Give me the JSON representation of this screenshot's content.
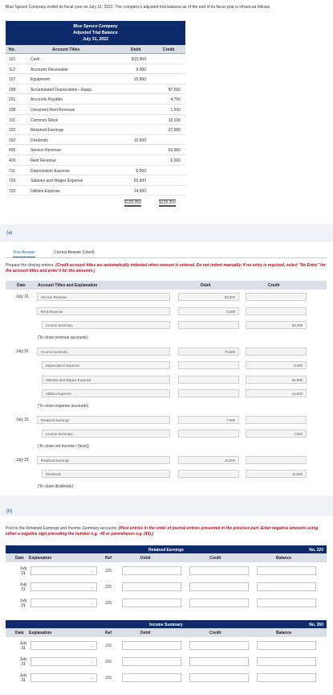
{
  "intro": "Blue Spruce Company ended its fiscal year on July 31, 2022. The company's adjusted trial balance as of the end of its fiscal year is shown as follows.",
  "trial_balance": {
    "title_lines": [
      "Blue Spruce Company",
      "Adjusted Trial Balance",
      "July 31, 2022"
    ],
    "headers": {
      "no": "No.",
      "account": "Account Titles",
      "debit": "Debit",
      "credit": "Credit"
    },
    "rows": [
      {
        "no": "101",
        "account": "Cash",
        "debit": "$10,450",
        "credit": ""
      },
      {
        "no": "112",
        "account": "Accounts Receivable",
        "debit": "9,000",
        "credit": ""
      },
      {
        "no": "157",
        "account": "Equipment",
        "debit": "15,500",
        "credit": ""
      },
      {
        "no": "158",
        "account": "Accumulated Depreciation—Equip.",
        "debit": "",
        "credit": "$7,000"
      },
      {
        "no": "201",
        "account": "Accounts Payable",
        "debit": "",
        "credit": "4,750"
      },
      {
        "no": "208",
        "account": "Unearned Rent Revenue",
        "debit": "",
        "credit": "1,500"
      },
      {
        "no": "311",
        "account": "Common Stock",
        "debit": "",
        "credit": "19,100"
      },
      {
        "no": "320",
        "account": "Retained Earnings",
        "debit": "",
        "credit": "27,000"
      },
      {
        "no": "332",
        "account": "Dividends",
        "debit": "16,500",
        "credit": ""
      },
      {
        "no": "400",
        "account": "Service Revenue",
        "debit": "",
        "credit": "63,000"
      },
      {
        "no": "429",
        "account": "Rent Revenue",
        "debit": "",
        "credit": "6,000"
      },
      {
        "no": "711",
        "account": "Depreciation Expense",
        "debit": "6,500",
        "credit": ""
      },
      {
        "no": "726",
        "account": "Salaries and Wages Expense",
        "debit": "55,900",
        "credit": ""
      },
      {
        "no": "732",
        "account": "Utilities Expense",
        "debit": "14,500",
        "credit": ""
      }
    ],
    "totals": {
      "debit": "$128,350",
      "credit": "$128,350"
    }
  },
  "part_a": {
    "label": "(a)",
    "tabs": [
      "Your Answer",
      "Correct Answer (Used)"
    ],
    "instruction": "Prepare the closing entries.",
    "instruction_red": "(Credit account titles are automatically indented when amount is entered. Do not indent manually. If no entry is required, select \"No Entry\" for the account titles and enter 0 for the amounts.)",
    "headers": {
      "date": "Date",
      "account": "Account Titles and Explanation",
      "debit": "Debit",
      "credit": "Credit"
    },
    "entries": [
      {
        "date": "July 31",
        "lines": [
          {
            "account": "Service Revenue",
            "debit": "63,000",
            "credit": ""
          },
          {
            "account": "Rent Revenue",
            "debit": "6,000",
            "credit": ""
          },
          {
            "account": "Income Summary",
            "debit": "",
            "credit": "69,000"
          }
        ],
        "note": "(To close revenue accounts)"
      },
      {
        "date": "July 31",
        "lines": [
          {
            "account": "Income Summary",
            "debit": "76,900",
            "credit": ""
          },
          {
            "account": "Depreciation Expense",
            "debit": "",
            "credit": "6,500"
          },
          {
            "account": "Salaries and Wages Expense",
            "debit": "",
            "credit": "55,900"
          },
          {
            "account": "Utilities Expense",
            "debit": "",
            "credit": "14,500"
          }
        ],
        "note": "(To close expense accounts)"
      },
      {
        "date": "July 31",
        "lines": [
          {
            "account": "Retained Earnings",
            "debit": "7,900",
            "credit": ""
          },
          {
            "account": "Income Summary",
            "debit": "",
            "credit": "7,900"
          }
        ],
        "note": "(To close net income / (loss))"
      },
      {
        "date": "July 31",
        "lines": [
          {
            "account": "Retained Earnings",
            "debit": "16,500",
            "credit": ""
          },
          {
            "account": "Dividends",
            "debit": "",
            "credit": "16,500"
          }
        ],
        "note": "(To close dividends)"
      }
    ]
  },
  "part_b": {
    "label": "(b)",
    "instruction": "Post to the Retained Earnings and Income Summary accounts.",
    "instruction_red": "(Post entries in the order of journal entries presented in the previous part. Enter negative amounts using either a negative sign preceding the number e.g. -45 or parentheses e.g. (45).)",
    "headers": {
      "date": "Date",
      "explanation": "Explanation",
      "ref": "Ref",
      "debit": "Debit",
      "credit": "Credit",
      "balance": "Balance"
    },
    "ledgers": [
      {
        "title": "Retained Earnings",
        "no": "No. 320",
        "rows": [
          {
            "date_l1": "July",
            "date_l2": "31",
            "ref": "J15"
          },
          {
            "date_l1": "July",
            "date_l2": "31",
            "ref": "J15"
          },
          {
            "date_l1": "July",
            "date_l2": "31",
            "ref": "J15"
          }
        ]
      },
      {
        "title": "Income Summary",
        "no": "No. 350",
        "rows": [
          {
            "date_l1": "July",
            "date_l2": "31",
            "ref": "J15"
          },
          {
            "date_l1": "July",
            "date_l2": "31",
            "ref": "J15"
          },
          {
            "date_l1": "July",
            "date_l2": "31",
            "ref": "J15"
          }
        ]
      }
    ]
  },
  "icons": {
    "dropdown": "chevron-down-icon"
  },
  "colors": {
    "header_navy": "#0d2a6b",
    "instruction_red": "#d0021b",
    "tab_blue": "#1a6fc0"
  }
}
